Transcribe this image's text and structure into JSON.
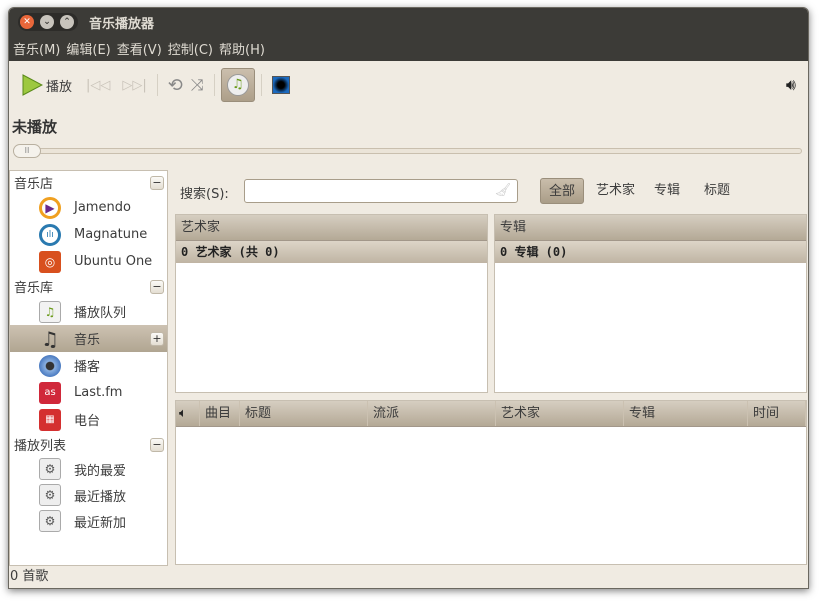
{
  "window": {
    "title": "音乐播放器"
  },
  "menu": [
    "音乐(M)",
    "编辑(E)",
    "查看(V)",
    "控制(C)",
    "帮助(H)"
  ],
  "toolbar": {
    "play_label": "播放"
  },
  "now_playing": "未播放",
  "progress": 0,
  "sidebar": {
    "sections": [
      {
        "label": "音乐店",
        "items": [
          {
            "label": "Jamendo",
            "icon": "jamendo-icon"
          },
          {
            "label": "Magnatune",
            "icon": "magnatune-icon"
          },
          {
            "label": "Ubuntu One",
            "icon": "ubuntu-one-icon"
          }
        ]
      },
      {
        "label": "音乐库",
        "items": [
          {
            "label": "播放队列",
            "icon": "play-queue-icon"
          },
          {
            "label": "音乐",
            "icon": "music-note-icon",
            "selected": true
          },
          {
            "label": "播客",
            "icon": "podcast-icon"
          },
          {
            "label": "Last.fm",
            "icon": "lastfm-icon"
          },
          {
            "label": "电台",
            "icon": "radio-icon"
          }
        ]
      },
      {
        "label": "播放列表",
        "items": [
          {
            "label": "我的最爱",
            "icon": "gear-icon"
          },
          {
            "label": "最近播放",
            "icon": "gear-icon"
          },
          {
            "label": "最近新加",
            "icon": "gear-icon"
          }
        ]
      }
    ]
  },
  "search": {
    "label": "搜索(S):",
    "value": ""
  },
  "filters": [
    "全部",
    "艺术家",
    "专辑",
    "标题"
  ],
  "artist_pane": {
    "header": "艺术家",
    "summary": "0 艺术家 (共 0)"
  },
  "album_pane": {
    "header": "专辑",
    "summary": "0 专辑 (0)"
  },
  "track_columns": [
    "曲目",
    "标题",
    "流派",
    "艺术家",
    "专辑",
    "时间"
  ],
  "status": "0 首歌"
}
